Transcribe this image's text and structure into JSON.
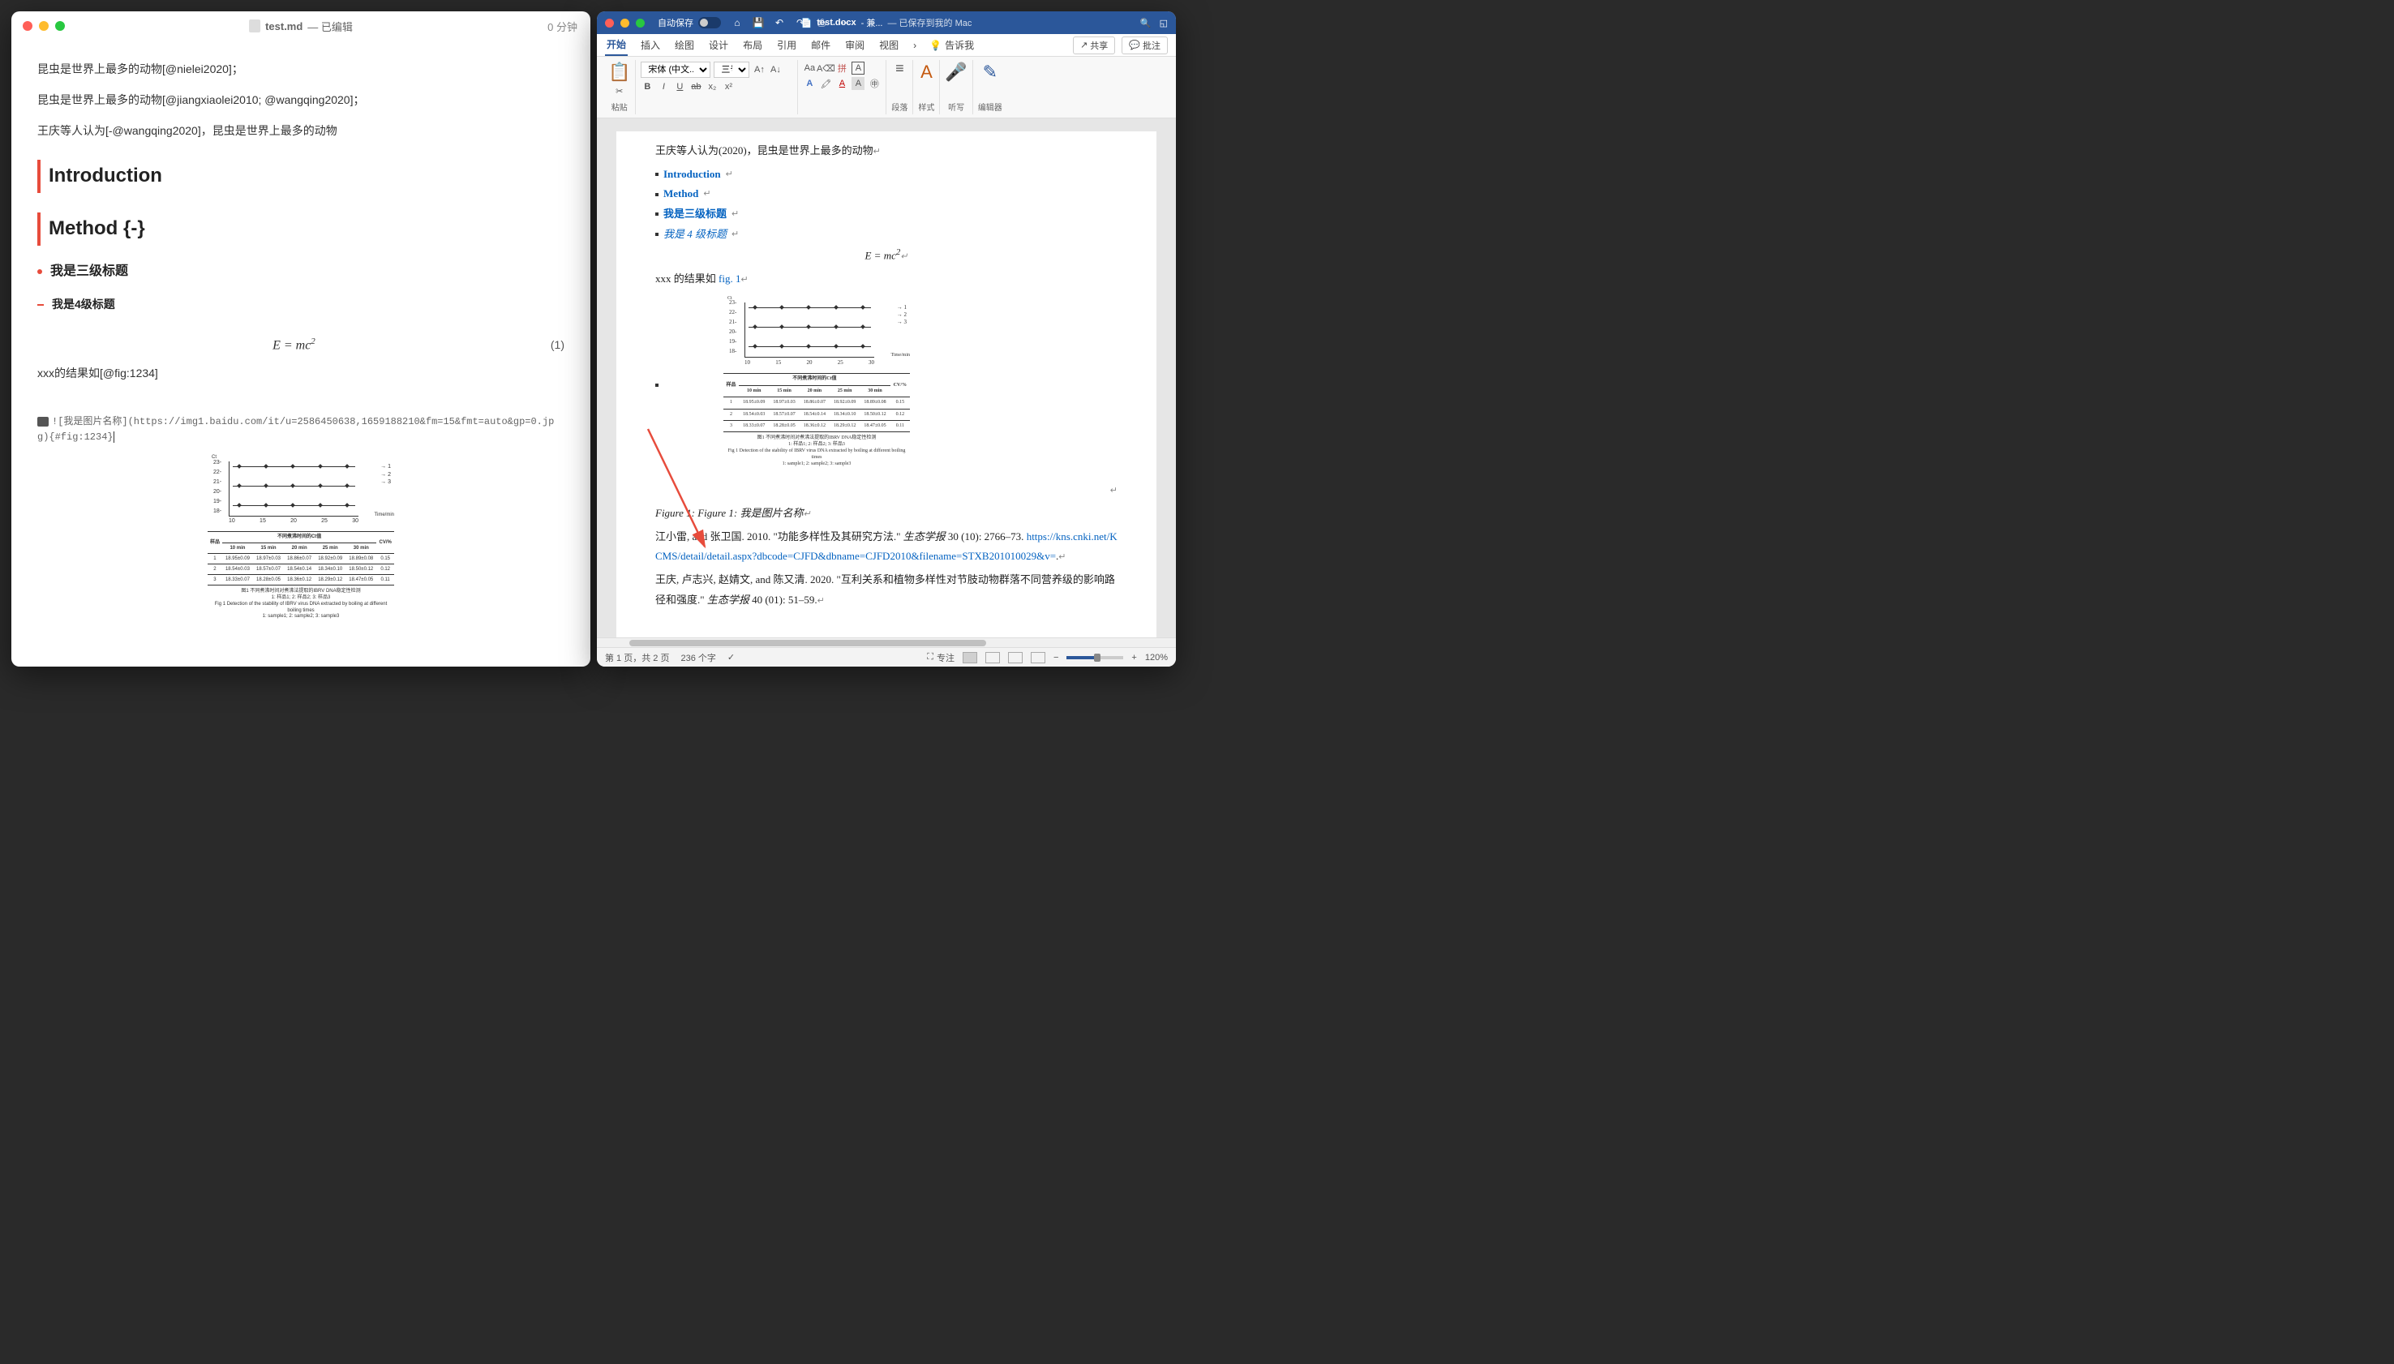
{
  "left": {
    "title_file": "test.md",
    "title_status": "— 已编辑",
    "title_right": "0 分钟",
    "para1": "昆虫是世界上最多的动物[@nielei2020]；",
    "para2": "昆虫是世界上最多的动物[@jiangxiaolei2010; @wangqing2020]；",
    "para3": "王庆等人认为[-@wangqing2020]，昆虫是世界上最多的动物",
    "h1_intro": "Introduction",
    "h1_method": "Method {-}",
    "h3": "我是三级标题",
    "h4": "我是4级标题",
    "formula": "E = mc",
    "formula_sup": "2",
    "eq_num": "(1)",
    "fig_ref": "xxx的结果如[@fig:1234]",
    "img_code": "![我是图片名称](https://img1.baidu.com/it/u=2586450638,1659188210&fm=15&fmt=auto&gp=0.jpg){#fig:1234}"
  },
  "word": {
    "autosave": "自动保存",
    "autosave_state": "关闭",
    "title_file": "test.docx",
    "title_compat": "- 兼...",
    "title_saved": "— 已保存到我的 Mac",
    "tabs": [
      "开始",
      "插入",
      "绘图",
      "设计",
      "布局",
      "引用",
      "邮件",
      "审阅",
      "视图"
    ],
    "tell_me": "告诉我",
    "share": "共享",
    "comments": "批注",
    "group_paste": "粘贴",
    "font_name": "宋体 (中文...",
    "font_size": "三号",
    "group_para": "段落",
    "group_style": "样式",
    "group_dictate": "听写",
    "group_editor": "编辑器",
    "doc": {
      "p0": "王庆等人认为(2020)，昆虫是世界上最多的动物",
      "toc": [
        {
          "label": "Introduction",
          "cls": ""
        },
        {
          "label": "Method",
          "cls": ""
        },
        {
          "label": "我是三级标题",
          "cls": ""
        },
        {
          "label": "我是 4 级标题",
          "cls": "h4"
        }
      ],
      "formula": "E = mc",
      "formula_sup": "2",
      "fig_ref_pre": "xxx 的结果如 ",
      "fig_ref_link": "fig. 1",
      "caption": "Figure 1: Figure 1: 我是图片名称",
      "ref1_a": "江小雷, and 张卫国. 2010. \"功能多样性及其研究方法.\" ",
      "ref1_j": "生态学报",
      "ref1_b": " 30 (10): 2766–73. ",
      "ref1_link": "https://kns.cnki.net/KCMS/detail/detail.aspx?dbcode=CJFD&dbname=CJFD2010&filename=STXB201010029&v=",
      "ref2_a": "王庆, 卢志兴, 赵婧文, and 陈又清. 2020. \"互利关系和植物多样性对节肢动物群落不同营养级的影响路径和强度.\" ",
      "ref2_j": "生态学报",
      "ref2_b": " 40 (01): 51–59."
    },
    "status": {
      "page": "第 1 页，共 2 页",
      "words": "236 个字",
      "focus": "专注",
      "zoom": "120%"
    }
  },
  "chart_data": {
    "type": "line",
    "ylabel": "Ct",
    "xlabel": "Time/min",
    "x": [
      10,
      15,
      20,
      25,
      30
    ],
    "yticks": [
      18,
      19,
      20,
      21,
      22,
      23
    ],
    "series": [
      {
        "name": "1",
        "values": [
          23,
          23,
          23,
          23,
          23
        ]
      },
      {
        "name": "2",
        "values": [
          21,
          21,
          21,
          21,
          21
        ]
      },
      {
        "name": "3",
        "values": [
          19,
          19,
          19,
          19,
          19
        ]
      }
    ],
    "table": {
      "header_top": "不同煮沸时间的Ct值",
      "col_sample": "样品",
      "cols": [
        "10 min",
        "15 min",
        "20 min",
        "25 min",
        "30 min"
      ],
      "cv_col": "CV/%",
      "rows": [
        {
          "s": "1",
          "v": [
            "18.95±0.09",
            "18.97±0.03",
            "18.86±0.07",
            "18.92±0.09",
            "18.89±0.08"
          ],
          "cv": "0.15"
        },
        {
          "s": "2",
          "v": [
            "18.54±0.03",
            "18.57±0.07",
            "18.54±0.14",
            "18.34±0.10",
            "18.50±0.12"
          ],
          "cv": "0.12"
        },
        {
          "s": "3",
          "v": [
            "18.33±0.07",
            "18.28±0.05",
            "18.36±0.12",
            "18.29±0.12",
            "18.47±0.05"
          ],
          "cv": "0.11"
        }
      ]
    },
    "caption_cn": "图1 不同煮沸时间对煮沸法提取的IBRV DNA稳定性检测",
    "caption_sub_cn": "1: 样品1; 2: 样品2; 3: 样品3",
    "caption_en": "Fig 1 Detection of the stability of IBRV virus DNA extracted by boiling at different boiling times",
    "caption_sub_en": "1: sample1; 2: sample2; 3: sample3"
  }
}
